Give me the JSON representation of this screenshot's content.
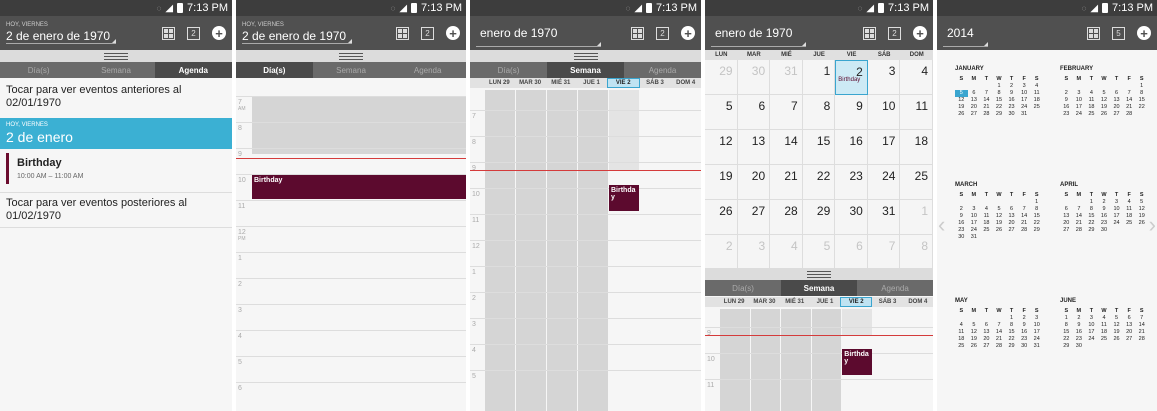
{
  "status_time": "7:13 PM",
  "tabs": [
    "Día(s)",
    "Semana",
    "Agenda"
  ],
  "screen1": {
    "today_small": "HOY, VIERNES",
    "date": "2 de enero de 1970",
    "earlier": "Tocar para ver eventos anteriores al 02/01/1970",
    "band_small": "HOY, VIERNES",
    "band_big": "2 de enero",
    "event_title": "Birthday",
    "event_time": "10:00 AM – 11:00 AM",
    "later": "Tocar para ver eventos posteriores al 01/02/1970"
  },
  "screen2": {
    "today_small": "HOY, VIERNES",
    "date": "2 de enero de 1970",
    "hours": [
      {
        "h": "7",
        "ap": "AM"
      },
      {
        "h": "8",
        "ap": ""
      },
      {
        "h": "9",
        "ap": ""
      },
      {
        "h": "10",
        "ap": ""
      },
      {
        "h": "11",
        "ap": ""
      },
      {
        "h": "12",
        "ap": "PM"
      },
      {
        "h": "1",
        "ap": ""
      },
      {
        "h": "2",
        "ap": ""
      },
      {
        "h": "3",
        "ap": ""
      },
      {
        "h": "4",
        "ap": ""
      },
      {
        "h": "5",
        "ap": ""
      },
      {
        "h": "6",
        "ap": ""
      }
    ],
    "event": "Birthday"
  },
  "screen3": {
    "title": "enero de 1970",
    "days": [
      "LUN 29",
      "MAR 30",
      "MIÉ 31",
      "JUE 1",
      "VIE 2",
      "SÁB 3",
      "DOM 4"
    ],
    "event": "Birthda y"
  },
  "screen4": {
    "title": "enero de 1970",
    "weekdays": [
      "LUN",
      "MAR",
      "MIÉ",
      "JUE",
      "VIE",
      "SÁB",
      "DOM"
    ],
    "weeks": [
      [
        "29",
        "30",
        "31",
        "1",
        "2",
        "3",
        "4"
      ],
      [
        "5",
        "6",
        "7",
        "8",
        "9",
        "10",
        "11"
      ],
      [
        "12",
        "13",
        "14",
        "15",
        "16",
        "17",
        "18"
      ],
      [
        "19",
        "20",
        "21",
        "22",
        "23",
        "24",
        "25"
      ],
      [
        "26",
        "27",
        "28",
        "29",
        "30",
        "31",
        "1"
      ],
      [
        "2",
        "3",
        "4",
        "5",
        "6",
        "7",
        "8"
      ]
    ],
    "birthday_label": "Birthday",
    "days": [
      "LUN 29",
      "MAR 30",
      "MIÉ 31",
      "JUE 1",
      "VIE 2",
      "SÁB 3",
      "DOM 4"
    ],
    "event": "Birthda y"
  },
  "screen5": {
    "year": "2014",
    "weekday_letters": [
      "S",
      "M",
      "T",
      "W",
      "T",
      "F",
      "S"
    ],
    "months": [
      {
        "name": "JANUARY",
        "lead": 3,
        "days": 31,
        "sel": 5
      },
      {
        "name": "FEBRUARY",
        "lead": 6,
        "days": 28,
        "sel": 0
      },
      {
        "name": "MARCH",
        "lead": 6,
        "days": 31,
        "sel": 0
      },
      {
        "name": "APRIL",
        "lead": 2,
        "days": 30,
        "sel": 0
      },
      {
        "name": "MAY",
        "lead": 4,
        "days": 31,
        "sel": 0
      },
      {
        "name": "JUNE",
        "lead": 0,
        "days": 30,
        "sel": 0
      }
    ]
  },
  "colors": {
    "accent": "#3bb0d3",
    "event": "#5c0a2e",
    "now_line": "#d43b3b"
  }
}
